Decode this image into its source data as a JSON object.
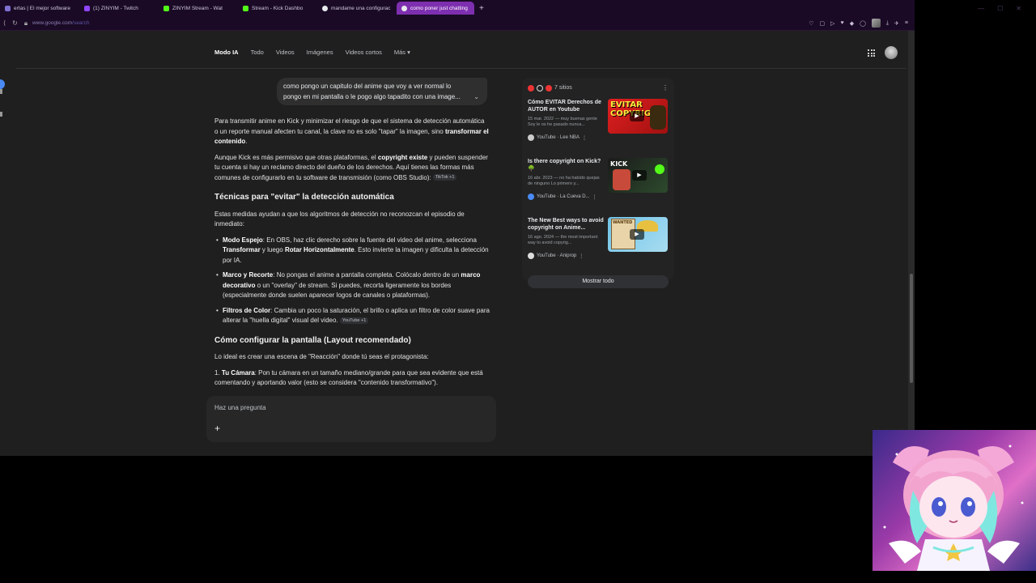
{
  "browser": {
    "tabs": [
      {
        "label": "ertas | El mejor software",
        "color": "#7f6fd0",
        "active": false
      },
      {
        "label": "(1) ZINYIM - Twitch",
        "color": "#9146ff",
        "active": false
      },
      {
        "label": "ZINYIM Stream - Wat",
        "color": "#53fc18",
        "active": false
      },
      {
        "label": "Stream - Kick Dashbo",
        "color": "#53fc18",
        "active": false
      },
      {
        "label": "mandame una configurac",
        "color": "#e8eaed",
        "active": false
      },
      {
        "label": "como poner just chatting",
        "color": "#e8eaed",
        "active": true
      }
    ],
    "new_tab": "+",
    "url_prefix": "www.google.com",
    "url_path": "/search"
  },
  "google_nav": {
    "items": [
      "Modo IA",
      "Todo",
      "Videos",
      "Imágenes",
      "Videos cortos",
      "Más ▾"
    ]
  },
  "query": "como pongo un capitulo del anime que voy a ver normal lo pongo en mi pantalla o le pogo algo tapadito con una image...",
  "answer": {
    "p1_a": "Para transmitir anime en Kick y minimizar el riesgo de que el sistema de detección automática o un reporte manual afecten tu canal, la clave no es solo \"tapar\" la imagen, sino ",
    "p1_b": "transformar el contenido",
    "p1_c": ".",
    "p2_a": "Aunque Kick es más permisivo que otras plataformas, el ",
    "p2_b": "copyright existe",
    "p2_c": " y pueden suspender tu cuenta si hay un reclamo directo del dueño de los derechos. Aquí tienes las formas más comunes de configurarlo en tu software de transmisión (como OBS Studio): ",
    "chip_tiktok": "TikTok +1",
    "h_tech": "Técnicas para \"evitar\" la detección automática",
    "p3": "Estas medidas ayudan a que los algoritmos de detección no reconozcan el episodio de inmediato:",
    "b1_t": "Modo Espejo",
    "b1_a": ": En OBS, haz clic derecho sobre la fuente del video del anime, selecciona ",
    "b1_b": "Transformar",
    "b1_c": " y luego ",
    "b1_d": "Rotar Horizontalmente",
    "b1_e": ". Esto invierte la imagen y dificulta la detección por IA.",
    "b2_t": "Marco y Recorte",
    "b2_a": ": No pongas el anime a pantalla completa. Colócalo dentro de un ",
    "b2_b": "marco decorativo",
    "b2_c": " o un \"overlay\" de stream. Si puedes, recorta ligeramente los bordes (especialmente donde suelen aparecer logos de canales o plataformas).",
    "b3_t": "Filtros de Color",
    "b3_a": ": Cambia un poco la saturación, el brillo o aplica un filtro de color suave para alterar la \"huella digital\" visual del video. ",
    "chip_youtube": "YouTube +1",
    "h_layout": "Cómo configurar la pantalla (Layout recomendado)",
    "p4": "Lo ideal es crear una escena de \"Reacción\" donde tú seas el protagonista:",
    "ol1_n": "1.",
    "ol1_t": "Tu Cámara",
    "ol1_a": ": Pon tu cámara en un tamaño mediano/grande para que sea evidente que está comentando y aportando valor (esto se considera \"contenido transformativo\")."
  },
  "ask": {
    "placeholder": "Haz una pregunta",
    "plus": "+"
  },
  "sources": {
    "count_label": "7 sitios",
    "cards": [
      {
        "title": "Cómo EVITAR Derechos de AUTOR en Youtube",
        "snippet": "15 mar. 2022 — muy buenas gente Soy le os he pasado nunca...",
        "source": "YouTube · Lee NBA",
        "thumb_text": "EVITAR COPYRIGHT"
      },
      {
        "title": "Is there copyright on Kick? 🌳",
        "snippet": "16 abr. 2023 — no ha habido quejas de ninguno Lo primero y...",
        "source": "YouTube · La Cueva D...",
        "thumb_text": "KICK"
      },
      {
        "title": "The New Best ways to avoid copyright on Anime...",
        "snippet": "16 ago. 2024 — the most important way to avoid copyrig...",
        "source": "YouTube · Aniprop",
        "thumb_text": "WANTED"
      }
    ],
    "show_all": "Mostrar todo"
  }
}
